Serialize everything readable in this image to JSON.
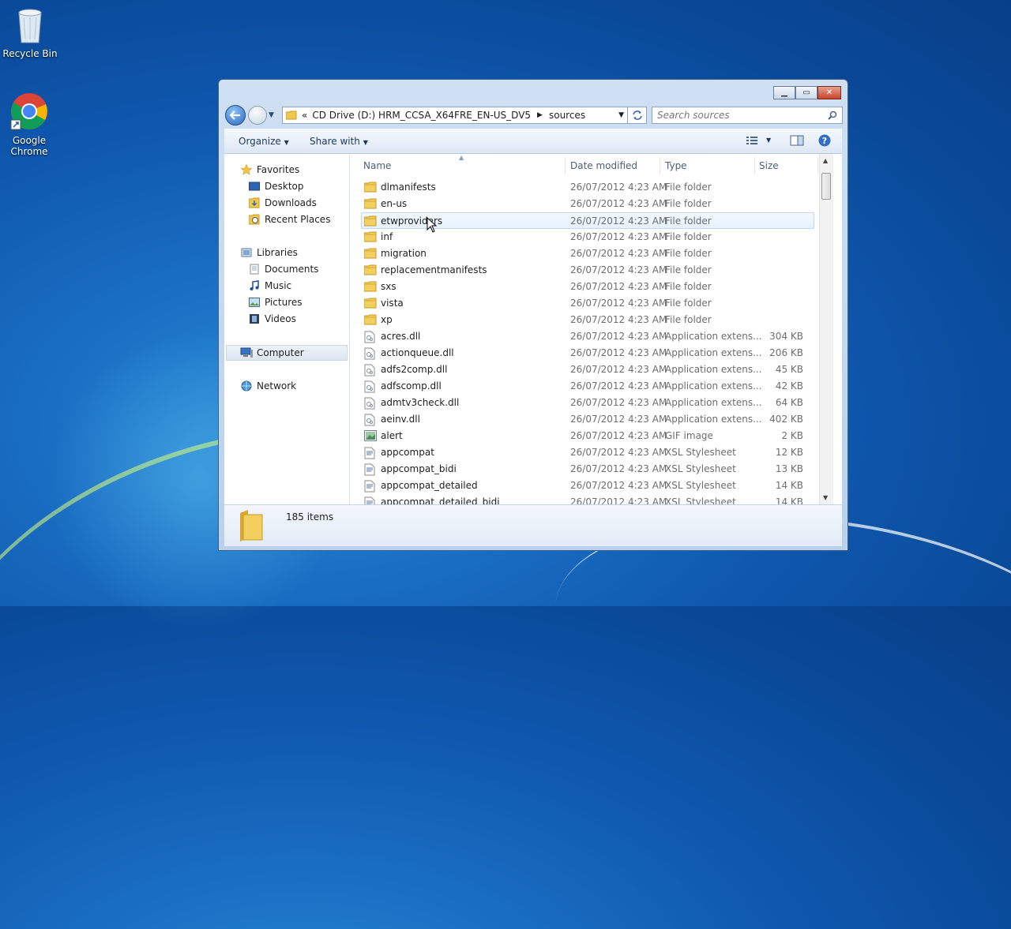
{
  "desktop": {
    "icons": [
      {
        "label": "Recycle Bin",
        "icon": "recycle-bin-icon"
      },
      {
        "label": "Google Chrome",
        "icon": "chrome-icon"
      }
    ]
  },
  "window": {
    "address": {
      "overflow": "«",
      "segments": [
        "CD Drive (D:) HRM_CCSA_X64FRE_EN-US_DV5",
        "sources"
      ]
    },
    "search_placeholder": "Search sources",
    "toolbar": {
      "organize": "Organize",
      "share_with": "Share with"
    },
    "nav": {
      "favorites": "Favorites",
      "desktop": "Desktop",
      "downloads": "Downloads",
      "recent": "Recent Places",
      "libraries": "Libraries",
      "documents": "Documents",
      "music": "Music",
      "pictures": "Pictures",
      "videos": "Videos",
      "computer": "Computer",
      "network": "Network"
    },
    "columns": {
      "name": "Name",
      "date": "Date modified",
      "type": "Type",
      "size": "Size"
    },
    "files": [
      {
        "name": "dlmanifests",
        "date": "26/07/2012 4:23 AM",
        "type": "File folder",
        "size": "",
        "kind": "folder"
      },
      {
        "name": "en-us",
        "date": "26/07/2012 4:23 AM",
        "type": "File folder",
        "size": "",
        "kind": "folder"
      },
      {
        "name": "etwproviders",
        "date": "26/07/2012 4:23 AM",
        "type": "File folder",
        "size": "",
        "kind": "folder",
        "selected": true
      },
      {
        "name": "inf",
        "date": "26/07/2012 4:23 AM",
        "type": "File folder",
        "size": "",
        "kind": "folder"
      },
      {
        "name": "migration",
        "date": "26/07/2012 4:23 AM",
        "type": "File folder",
        "size": "",
        "kind": "folder"
      },
      {
        "name": "replacementmanifests",
        "date": "26/07/2012 4:23 AM",
        "type": "File folder",
        "size": "",
        "kind": "folder"
      },
      {
        "name": "sxs",
        "date": "26/07/2012 4:23 AM",
        "type": "File folder",
        "size": "",
        "kind": "folder"
      },
      {
        "name": "vista",
        "date": "26/07/2012 4:23 AM",
        "type": "File folder",
        "size": "",
        "kind": "folder"
      },
      {
        "name": "xp",
        "date": "26/07/2012 4:23 AM",
        "type": "File folder",
        "size": "",
        "kind": "folder"
      },
      {
        "name": "acres.dll",
        "date": "26/07/2012 4:23 AM",
        "type": "Application extens...",
        "size": "304 KB",
        "kind": "dll"
      },
      {
        "name": "actionqueue.dll",
        "date": "26/07/2012 4:23 AM",
        "type": "Application extens...",
        "size": "206 KB",
        "kind": "dll"
      },
      {
        "name": "adfs2comp.dll",
        "date": "26/07/2012 4:23 AM",
        "type": "Application extens...",
        "size": "45 KB",
        "kind": "dll"
      },
      {
        "name": "adfscomp.dll",
        "date": "26/07/2012 4:23 AM",
        "type": "Application extens...",
        "size": "42 KB",
        "kind": "dll"
      },
      {
        "name": "admtv3check.dll",
        "date": "26/07/2012 4:23 AM",
        "type": "Application extens...",
        "size": "64 KB",
        "kind": "dll"
      },
      {
        "name": "aeinv.dll",
        "date": "26/07/2012 4:23 AM",
        "type": "Application extens...",
        "size": "402 KB",
        "kind": "dll"
      },
      {
        "name": "alert",
        "date": "26/07/2012 4:23 AM",
        "type": "GIF image",
        "size": "2 KB",
        "kind": "gif"
      },
      {
        "name": "appcompat",
        "date": "26/07/2012 4:23 AM",
        "type": "XSL Stylesheet",
        "size": "12 KB",
        "kind": "xsl"
      },
      {
        "name": "appcompat_bidi",
        "date": "26/07/2012 4:23 AM",
        "type": "XSL Stylesheet",
        "size": "13 KB",
        "kind": "xsl"
      },
      {
        "name": "appcompat_detailed",
        "date": "26/07/2012 4:23 AM",
        "type": "XSL Stylesheet",
        "size": "14 KB",
        "kind": "xsl"
      },
      {
        "name": "appcompat_detailed_bidi",
        "date": "26/07/2012 4:23 AM",
        "type": "XSL Stylesheet",
        "size": "14 KB",
        "kind": "xsl"
      }
    ],
    "status": "185 items"
  }
}
